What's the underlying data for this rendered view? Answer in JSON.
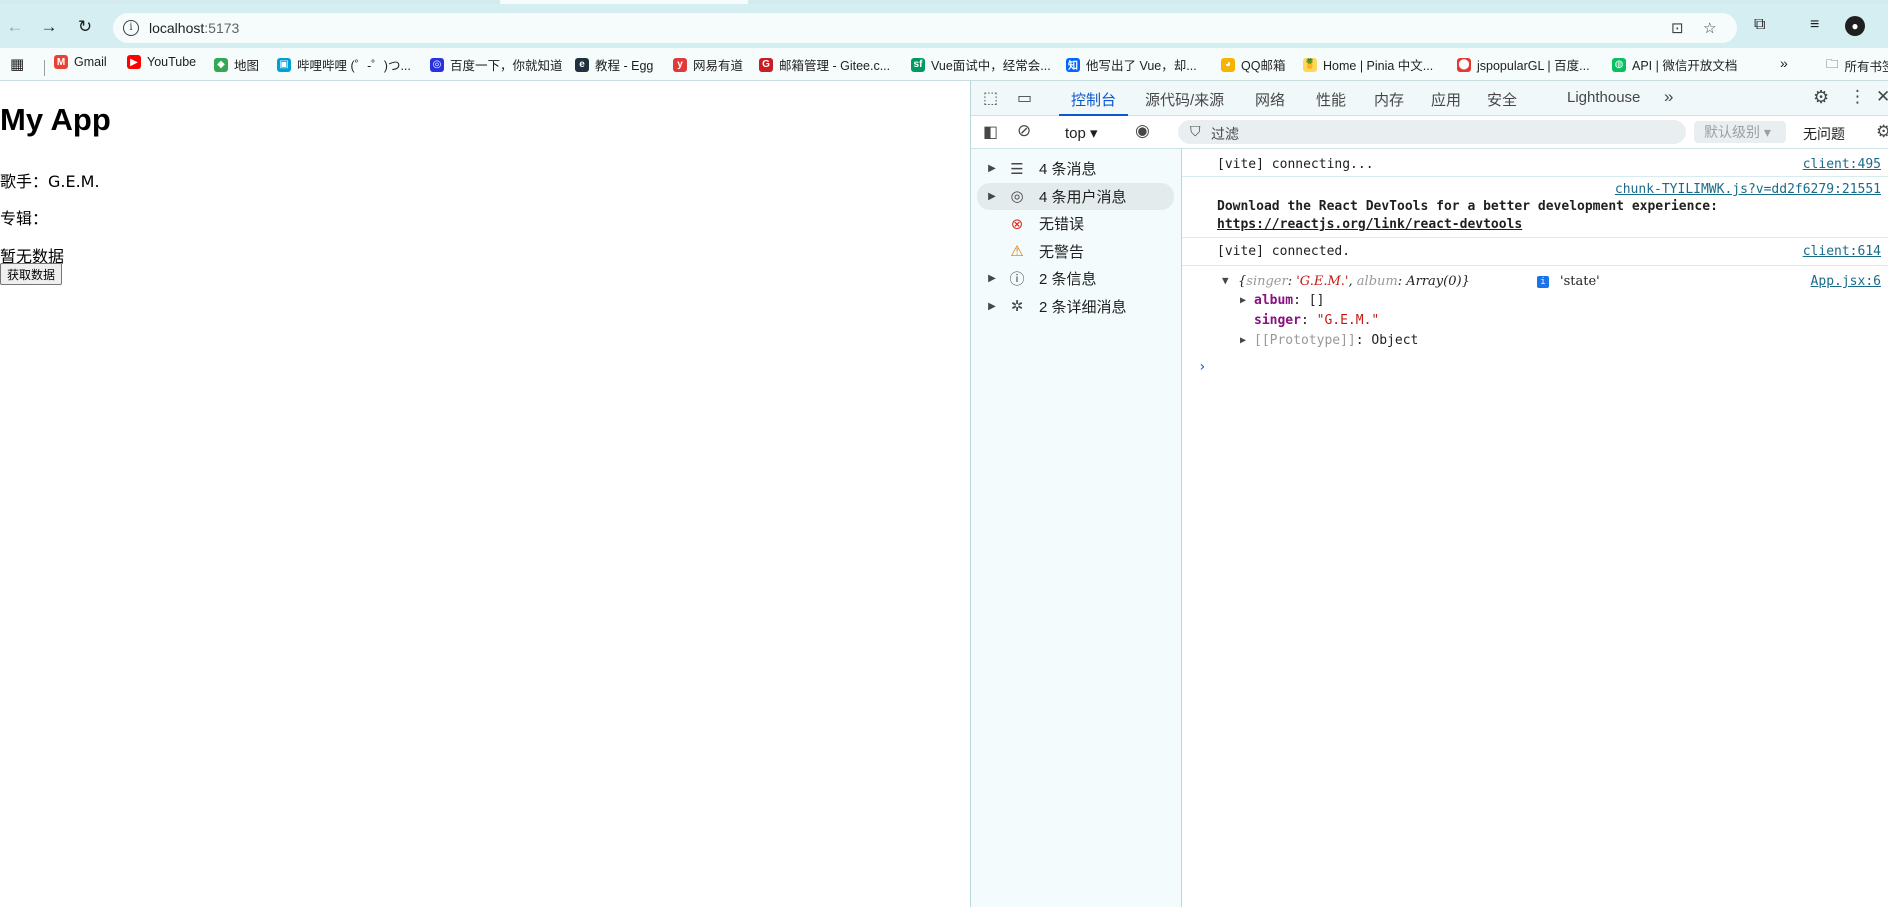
{
  "browser": {
    "url_host": "localhost",
    "url_port": ":5173",
    "bookmarks": [
      {
        "label": "Gmail",
        "icon": "gmail-icon",
        "color": "#ea4335"
      },
      {
        "label": "YouTube",
        "icon": "youtube-icon",
        "color": "#ff0000"
      },
      {
        "label": "地图",
        "icon": "maps-icon",
        "color": "#34a853"
      },
      {
        "label": "哔哩哔哩 (゜-゜)つ...",
        "icon": "bilibili-icon",
        "color": "#00a1d6"
      },
      {
        "label": "百度一下，你就知道",
        "icon": "baidu-icon",
        "color": "#2932e1"
      },
      {
        "label": "教程 - Egg",
        "icon": "egg-icon",
        "color": "#22313f"
      },
      {
        "label": "网易有道",
        "icon": "youdao-icon",
        "color": "#e03a3a"
      },
      {
        "label": "邮箱管理 - Gitee.c...",
        "icon": "gitee-icon",
        "color": "#c71d23"
      },
      {
        "label": "Vue面试中，经常会...",
        "icon": "segmentfault-icon",
        "color": "#009a61"
      },
      {
        "label": "他写出了 Vue，却...",
        "icon": "zhihu-icon",
        "color": "#0066ff"
      },
      {
        "label": "QQ邮箱",
        "icon": "qqmail-icon",
        "color": "#f4b400"
      },
      {
        "label": "Home | Pinia 中文...",
        "icon": "pinia-icon",
        "color": "#ffd859"
      },
      {
        "label": "jspopularGL | 百度...",
        "icon": "location-pin-icon",
        "color": "#e53935"
      },
      {
        "label": "API | 微信开放文档",
        "icon": "wechat-icon",
        "color": "#07c160"
      }
    ],
    "all_bookmarks_label": "所有书签"
  },
  "app": {
    "title": "My App",
    "singer_line": "歌手：G.E.M.",
    "album_line": "专辑：",
    "empty_text": "暂无数据",
    "fetch_button": "获取数据"
  },
  "devtools": {
    "tabs": [
      "控制台",
      "源代码/来源",
      "网络",
      "性能",
      "内存",
      "应用",
      "安全",
      "Lighthouse"
    ],
    "context": "top",
    "filter_placeholder": "过滤",
    "levels": "默认级别",
    "issues": "无问题",
    "sidebar": [
      {
        "label": "4 条消息",
        "icon": "list-icon",
        "expandable": true
      },
      {
        "label": "4 条用户消息",
        "icon": "user-icon",
        "expandable": true,
        "selected": true
      },
      {
        "label": "无错误",
        "icon": "error-icon",
        "expandable": false
      },
      {
        "label": "无警告",
        "icon": "warning-icon",
        "expandable": false
      },
      {
        "label": "2 条信息",
        "icon": "info-icon",
        "expandable": true
      },
      {
        "label": "2 条详细消息",
        "icon": "bug-icon",
        "expandable": true
      }
    ],
    "console": {
      "m1_text": "[vite] connecting...",
      "m1_src": "client:495",
      "m2_src": "chunk-TYILIMWK.js?v=dd2f6279:21551",
      "m2_text": "Download the React DevTools for a better development experience:",
      "m2_link": "https://reactjs.org/link/react-devtools",
      "m3_text": "[vite] connected.",
      "m3_src": "client:614",
      "obj_src": "App.jsx:6",
      "obj_preview_open": "{",
      "obj_k1": "singer",
      "obj_v1": "'G.E.M.'",
      "obj_k2": "album",
      "obj_v2": "Array(0)",
      "obj_close": "}",
      "obj_state": "'state'",
      "prop_album_key": "album",
      "prop_album_val": "[]",
      "prop_singer_key": "singer",
      "prop_singer_val": "\"G.E.M.\"",
      "prop_proto_key": "[[Prototype]]",
      "prop_proto_val": "Object"
    }
  }
}
